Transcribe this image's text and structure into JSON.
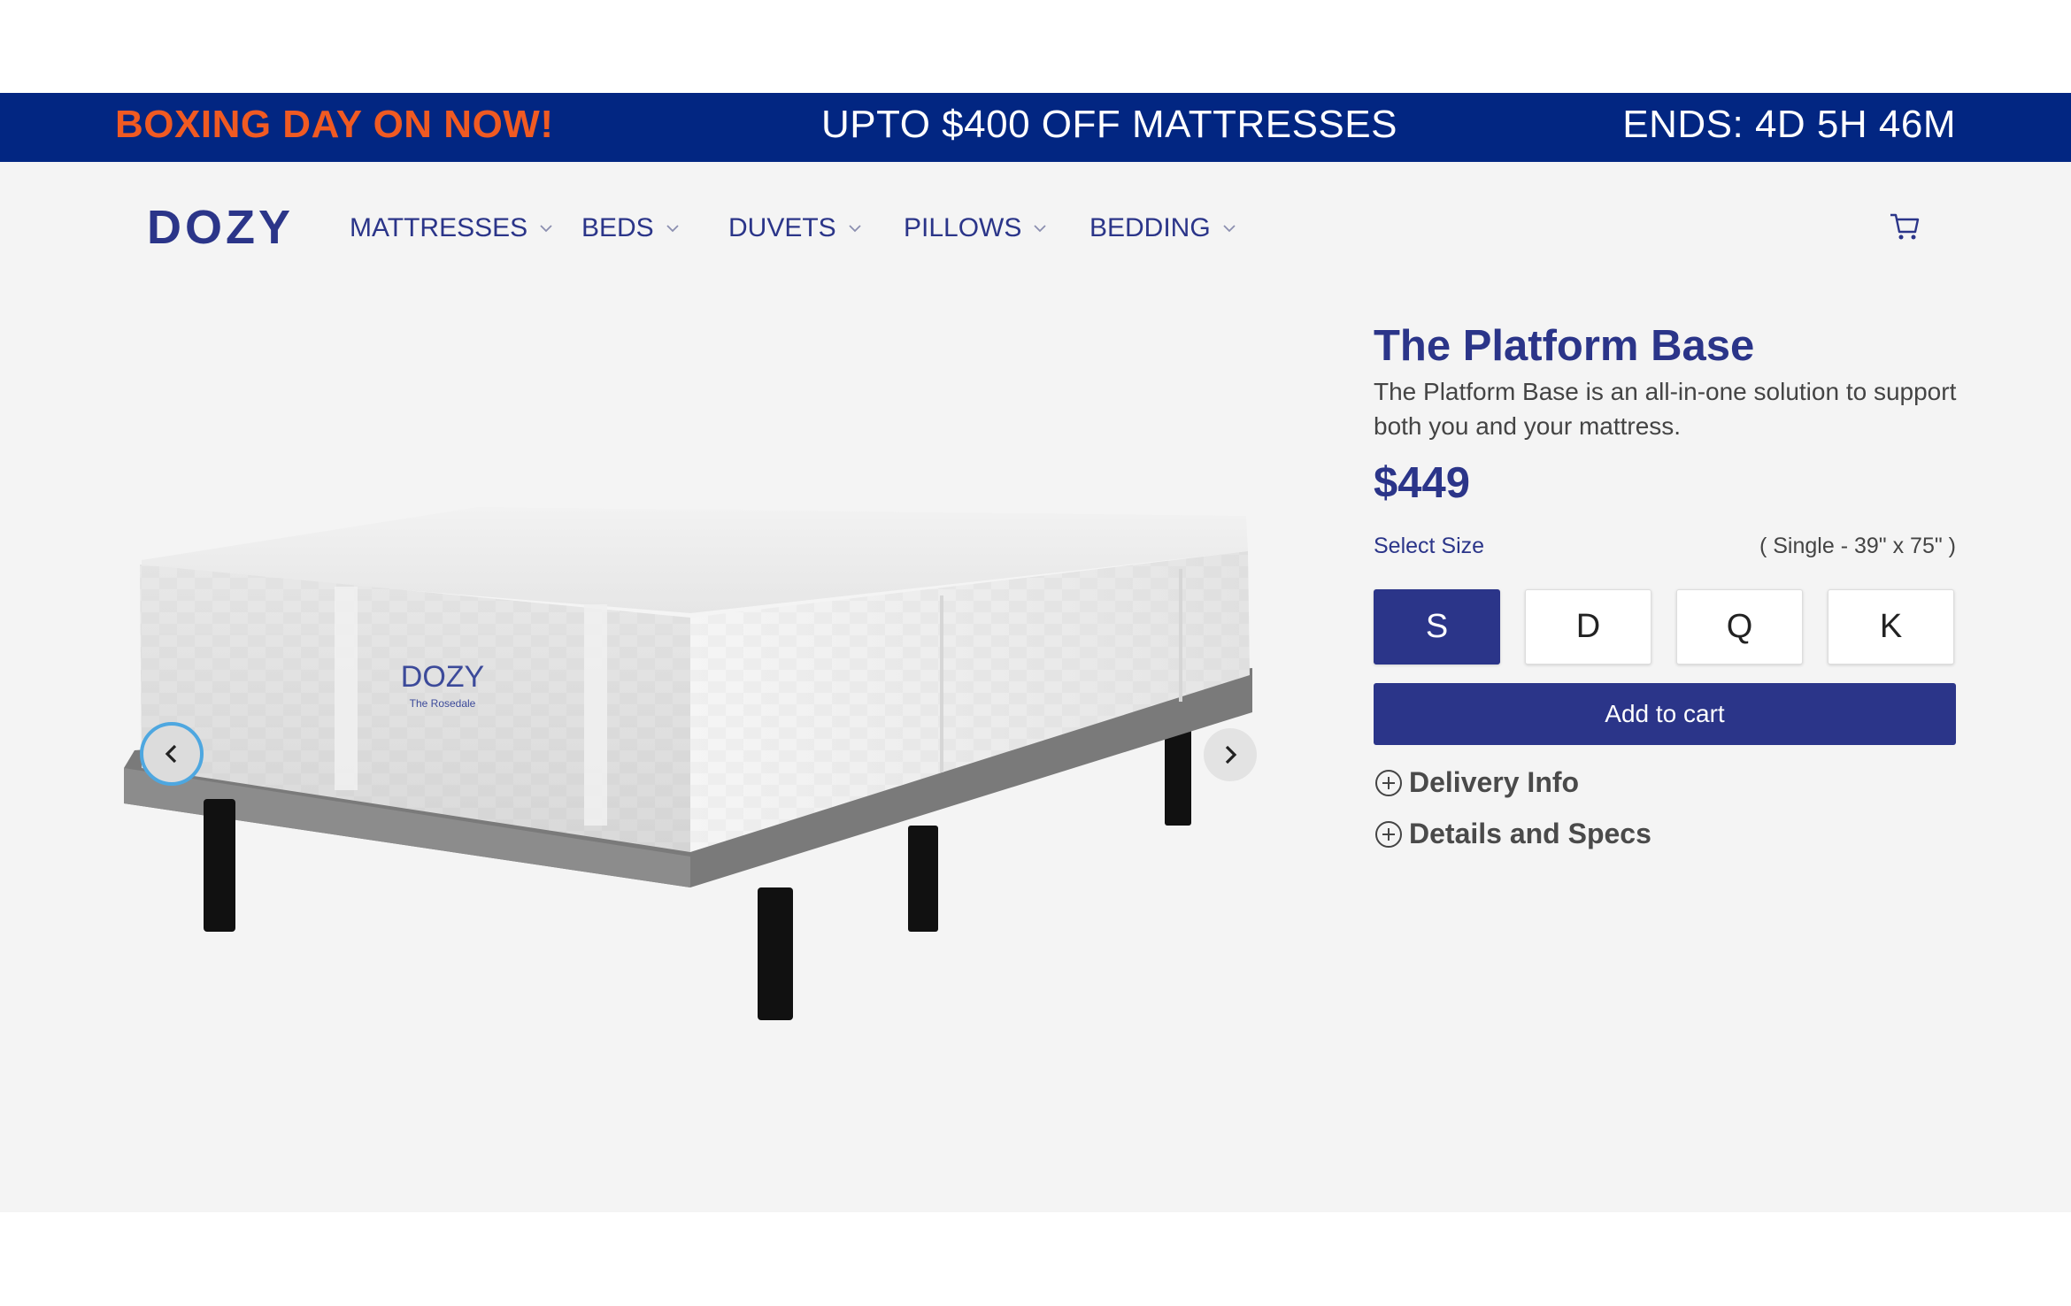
{
  "promo": {
    "left": "BOXING DAY ON NOW!",
    "middle": "UPTO $400 OFF MATTRESSES",
    "right": "ENDS: 4D 5H 46M",
    "accent_color": "#f05a22",
    "bar_color": "#022682"
  },
  "header": {
    "logo": "DOZY",
    "nav": [
      {
        "label": "MATTRESSES"
      },
      {
        "label": "BEDS"
      },
      {
        "label": "DUVETS"
      },
      {
        "label": "PILLOWS"
      },
      {
        "label": "BEDDING"
      }
    ],
    "cart_icon": "cart-icon"
  },
  "product": {
    "title": "The Platform Base",
    "description": "The Platform Base is an all-in-one solution to support both you and your mattress.",
    "price": "$449",
    "size_label": "Select Size",
    "size_desc": "( Single - 39\" x 75\" )",
    "sizes": [
      "S",
      "D",
      "Q",
      "K"
    ],
    "selected_size": "S",
    "add_to_cart": "Add to cart",
    "accordions": [
      "Delivery Info",
      "Details and Specs"
    ],
    "mattress_logo": "DOZY",
    "mattress_sublabel": "The Rosedale",
    "brand_color": "#2b3589"
  }
}
